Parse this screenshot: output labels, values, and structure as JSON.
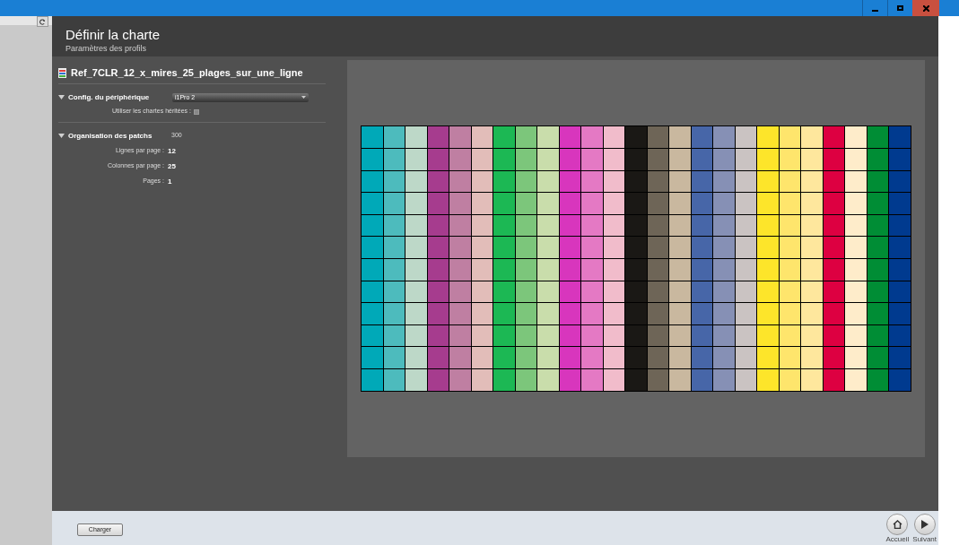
{
  "header": {
    "title": "Définir la charte",
    "subtitle": "Paramètres des profils"
  },
  "chart_name": "Ref_7CLR_12_x_mires_25_plages_sur_une_ligne",
  "device_config": {
    "label": "Config. du périphérique",
    "expanded": true,
    "device": "i1Pro 2",
    "inherit_label": "Utiliser les chartes héritées :",
    "inherit_checked": false
  },
  "patch_organisation": {
    "label": "Organisation des patchs",
    "expanded": true,
    "total": "300",
    "fields": [
      {
        "label": "Lignes par page :",
        "value": "12"
      },
      {
        "label": "Colonnes par page :",
        "value": "25"
      },
      {
        "label": "Pages :",
        "value": "1"
      }
    ]
  },
  "patch_columns": [
    {
      "color": "#00a9b8"
    },
    {
      "color": "#4dbbbd"
    },
    {
      "color": "#bdd8c8"
    },
    {
      "color": "#a63c8e"
    },
    {
      "color": "#bf7fa2"
    },
    {
      "color": "#e2bdb9"
    },
    {
      "color": "#1cb854"
    },
    {
      "color": "#7cc67b"
    },
    {
      "color": "#c9ddab"
    },
    {
      "color": "#d836bd"
    },
    {
      "color": "#e479c4"
    },
    {
      "color": "#f1bccb"
    },
    {
      "color": "#1a1815"
    },
    {
      "color": "#6e6557"
    },
    {
      "color": "#c9b89f"
    },
    {
      "color": "#4766a8"
    },
    {
      "color": "#8690b5"
    },
    {
      "color": "#cac3c2"
    },
    {
      "color": "#fde52a"
    },
    {
      "color": "#fee56c"
    },
    {
      "color": "#fee79d"
    },
    {
      "color": "#dd0041"
    },
    {
      "color": "#feecca"
    },
    {
      "color": "#008d35"
    },
    {
      "color": "#003a8f"
    }
  ],
  "footer": {
    "load_button": "Charger",
    "home_label": "Accueil",
    "next_label": "Suivant"
  }
}
